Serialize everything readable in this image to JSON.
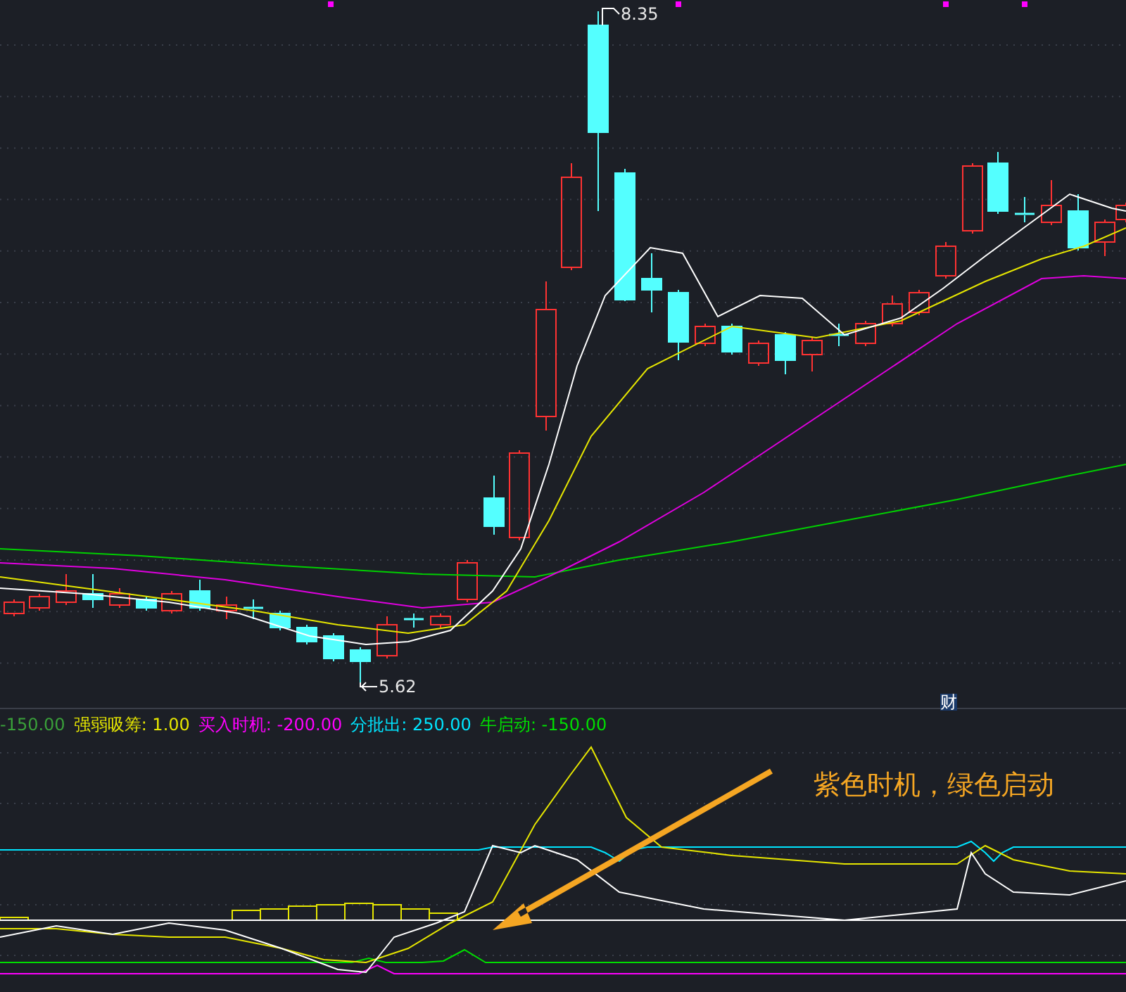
{
  "main_chart": {
    "high_label": "8.35",
    "low_label": "5.62",
    "event_marker": "财"
  },
  "indicator_legend": [
    {
      "text": "-150.00",
      "color": "#3aa03a"
    },
    {
      "text": "强弱吸筹: 1.00",
      "color": "#e6e600"
    },
    {
      "text": "买入时机: -200.00",
      "color": "#ff00ff"
    },
    {
      "text": "分批出: 250.00",
      "color": "#00e5ff"
    },
    {
      "text": "牛启动: -150.00",
      "color": "#00dd00"
    }
  ],
  "annotation": {
    "text": "紫色时机，绿色启动"
  }
}
